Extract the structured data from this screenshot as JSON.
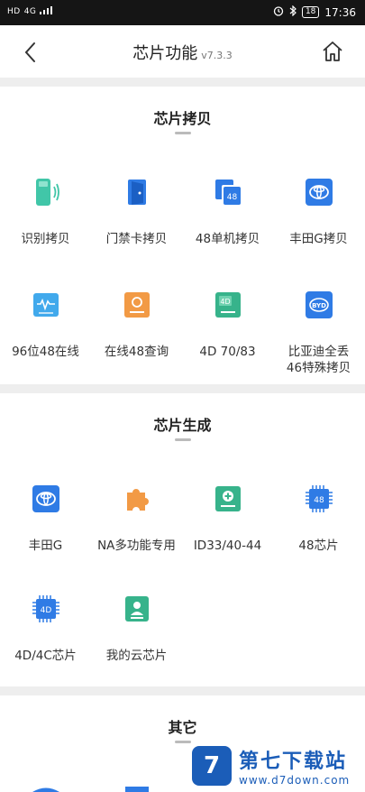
{
  "status": {
    "left_icons": [
      "HD",
      "4G",
      "signal-bars"
    ],
    "right_icons": [
      "alarm-icon",
      "bluetooth-icon"
    ],
    "battery": "18",
    "time": "17:36"
  },
  "nav": {
    "title": "芯片功能",
    "version": "v7.3.3"
  },
  "sections": {
    "copy": {
      "title": "芯片拷贝",
      "items": [
        "识别拷贝",
        "门禁卡拷贝",
        "48单机拷贝",
        "丰田G拷贝",
        "96位48在线",
        "在线48查询",
        "4D 70/83",
        "比亚迪全丢",
        "46特殊拷贝"
      ]
    },
    "generate": {
      "title": "芯片生成",
      "items": [
        "丰田G",
        "NA多功能专用",
        "ID33/40-44",
        "48芯片",
        "4D/4C芯片",
        "我的云芯片"
      ]
    },
    "other": {
      "title": "其它"
    }
  },
  "icon_text": {
    "c48": "48",
    "c4d": "4D",
    "byd": "BYD",
    "g48": "48",
    "g4d": "4D"
  },
  "watermark": {
    "logo": "7",
    "title": "第七下载站",
    "url": "www.d7down.com"
  },
  "colors": {
    "blue": "#2f7be5",
    "teal": "#41c6a8",
    "orange": "#f29a45",
    "green": "#37b38b",
    "brand": "#1b5db8"
  }
}
